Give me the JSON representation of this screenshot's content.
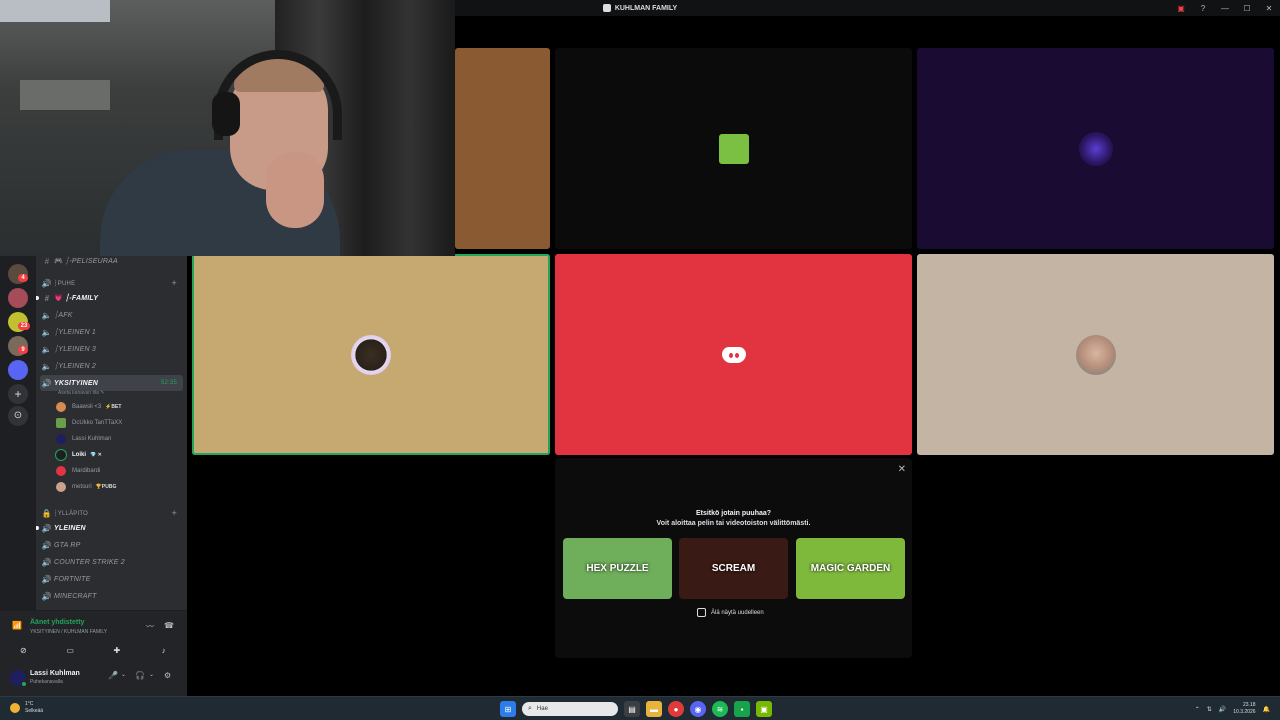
{
  "window": {
    "title": "KUHLMAN FAMILY"
  },
  "rail": {
    "badges": [
      "4",
      "23",
      "9",
      "3"
    ]
  },
  "sidebar": {
    "items": [
      {
        "kind": "text",
        "emoji": "🎮",
        "label": "┆-PELISEURAA"
      },
      {
        "kind": "cat",
        "label": "┆PUHE"
      },
      {
        "kind": "text",
        "emoji": "💗",
        "label": "┆-FAMILY"
      },
      {
        "kind": "voice",
        "label": "┆AFK"
      },
      {
        "kind": "voice",
        "label": "┆YLEINEN 1"
      },
      {
        "kind": "voice",
        "label": "┆YLEINEN 3"
      },
      {
        "kind": "voice",
        "label": "┆YLEINEN 2"
      },
      {
        "kind": "voice",
        "label": "YKSITYINEN",
        "timer": "52:35"
      }
    ],
    "channel_status": "Aseta kanavan tila ✎",
    "voice_users": [
      {
        "name": "Baawsli <3",
        "tag": "⚡BET",
        "color": "#d68b4f"
      },
      {
        "name": "DcUkko TanTTaXX",
        "tag": "",
        "color": "#6b9e4a"
      },
      {
        "name": "Lassi Kuhlman",
        "tag": "",
        "color": "#1e1f5e"
      },
      {
        "name": "Loiki",
        "tag": "💎 ✕",
        "color": "#23a55a"
      },
      {
        "name": "Mardibardi",
        "tag": "",
        "color": "#e13440"
      },
      {
        "name": "metsuri",
        "tag": "🏆PUBG",
        "color": "#c9a28a"
      }
    ],
    "lower": [
      {
        "kind": "cat",
        "label": "┆YLLÄPITO"
      },
      {
        "kind": "voice",
        "label": "YLEINEN"
      },
      {
        "kind": "voice",
        "label": "GTA RP"
      },
      {
        "kind": "voice",
        "label": "COUNTER STRIKE 2"
      },
      {
        "kind": "voice",
        "label": "FORTNITE"
      },
      {
        "kind": "voice",
        "label": "MINECRAFT"
      }
    ]
  },
  "voice_panel": {
    "status": "Äänet yhdistetty",
    "location": "YKSITYINEN / KUHLMAN FAMILY"
  },
  "user_panel": {
    "name": "Lassi Kuhlman",
    "status": "Puhekanavalla"
  },
  "activity": {
    "question": "Etsitkö jotain puuhaa?",
    "subtitle": "Voit aloittaa pelin tai videotoiston välittömästi.",
    "games": [
      {
        "name": "HEX PUZZLE",
        "bg": "#6fae5a"
      },
      {
        "name": "SCREAM",
        "bg": "#3a1a14"
      },
      {
        "name": "MAGIC GARDEN",
        "bg": "#7fb93c"
      }
    ],
    "dont_show": "Älä näytä uudelleen"
  },
  "taskbar": {
    "weather_temp": "1°C",
    "weather_text": "Selkeää",
    "search_placeholder": "Hae",
    "time": "23.18",
    "date": "10.3.2026"
  },
  "colors": {
    "accent_green": "#23a55a",
    "discord_red": "#e13440"
  }
}
